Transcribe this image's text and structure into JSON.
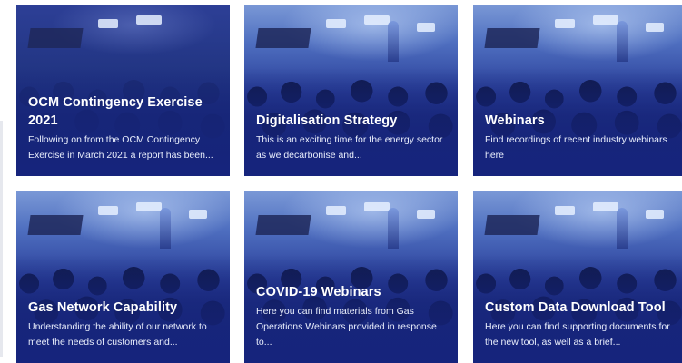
{
  "cards": [
    {
      "title": "OCM Contingency Exercise 2021",
      "description": "Following on from the OCM Contingency Exercise in March 2021 a report has been..."
    },
    {
      "title": "Digitalisation Strategy",
      "description": "This is an exciting time for the energy sector as we decarbonise and..."
    },
    {
      "title": "Webinars",
      "description": "Find recordings of recent industry webinars here"
    },
    {
      "title": "Gas Network Capability",
      "description": "Understanding the ability of our network to meet the needs of customers and..."
    },
    {
      "title": "COVID-19 Webinars",
      "description": "Here you can find materials from Gas Operations Webinars provided in response to..."
    },
    {
      "title": "Custom Data Download Tool",
      "description": "Here you can find supporting documents for the new tool, as well as a brief..."
    }
  ],
  "colors": {
    "card_overlay": "#1b2f86",
    "text": "#ffffff"
  }
}
